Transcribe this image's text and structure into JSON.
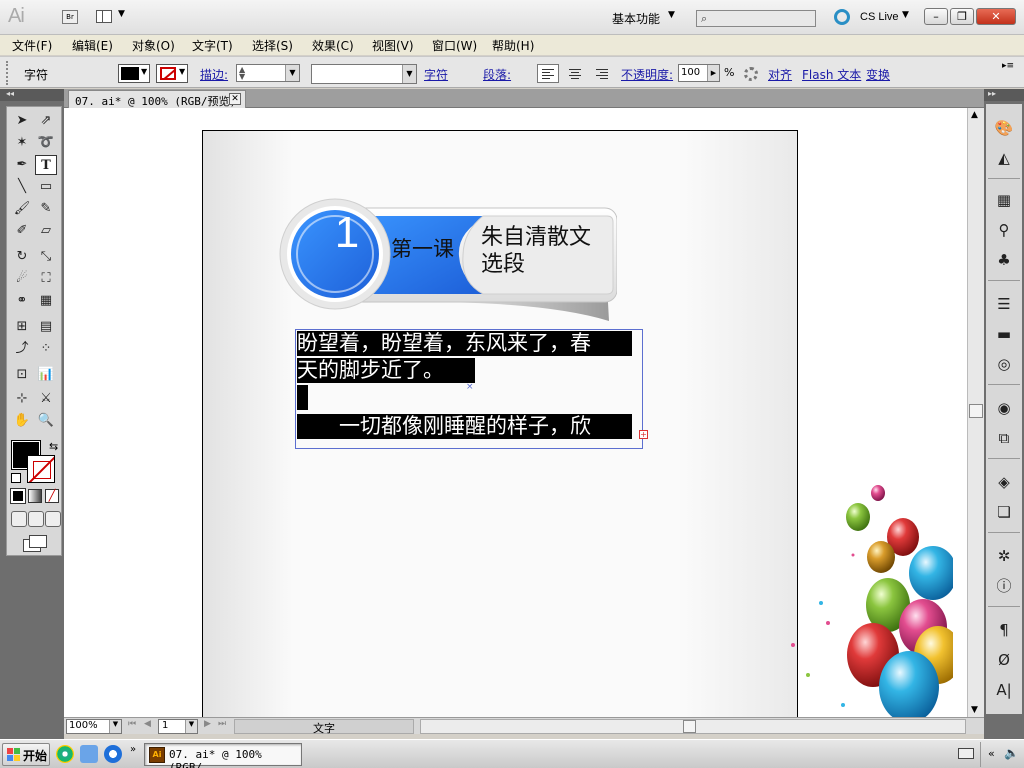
{
  "titlebar": {
    "app_logo": "Ai",
    "bridge_label": "Br",
    "workspace_label": "基本功能",
    "search_placeholder": "",
    "cslive_label": "CS Live",
    "minimize": "–",
    "restore": "❐",
    "close": "✕"
  },
  "menubar": {
    "items": [
      "文件(F)",
      "编辑(E)",
      "对象(O)",
      "文字(T)",
      "选择(S)",
      "效果(C)",
      "视图(V)",
      "窗口(W)",
      "帮助(H)"
    ]
  },
  "controlbar": {
    "type_label": "字符",
    "stroke_label": "描边:",
    "character_link": "字符",
    "paragraph_label": "段落:",
    "opacity_label": "不透明度:",
    "opacity_value": "100",
    "opacity_unit": "%",
    "align_link": "对齐",
    "flash_text_link": "Flash 文本",
    "transform_link": "变换",
    "fill_color": "#000000",
    "stroke_color": "#cc0000"
  },
  "document": {
    "tab_title": "07. ai* @ 100% (RGB/预览)",
    "lesson_number": "1",
    "lesson_label": "第一课",
    "lesson_title": "朱自清散文选段",
    "text_lines": [
      "盼望着，盼望着，东风来了，春",
      "天的脚步近了。",
      "",
      "　　一切都像刚睡醒的样子，欣"
    ],
    "accent_color": "#2a7ff0"
  },
  "statusbar": {
    "zoom": "100%",
    "page": "1",
    "status_text": "文字"
  },
  "taskbar": {
    "start_label": "开始",
    "task_label": "07. ai* @ 100% (RGB/..."
  }
}
